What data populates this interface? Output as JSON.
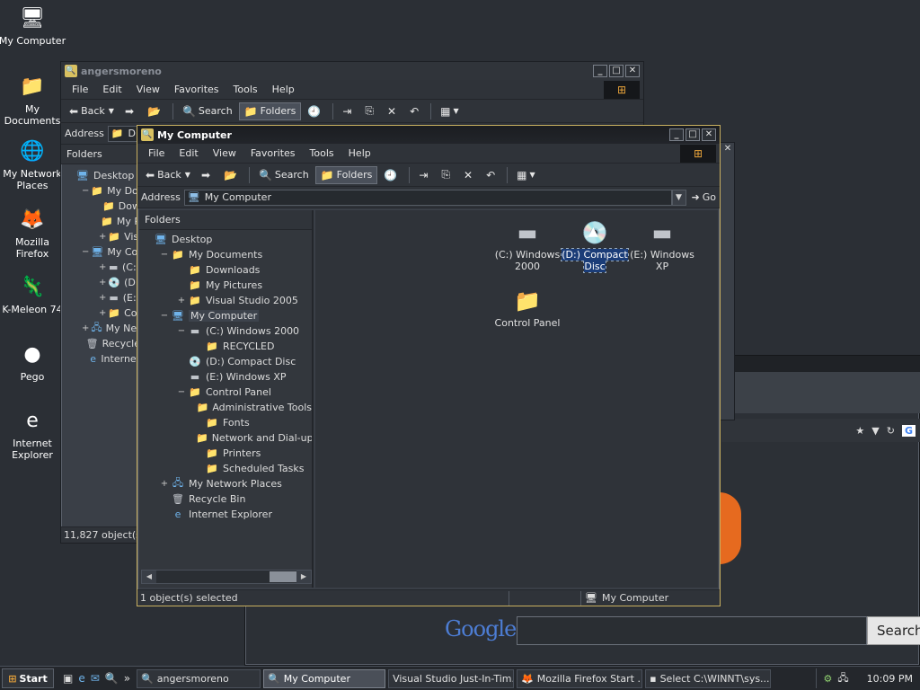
{
  "desktop": {
    "icons": [
      {
        "label": "My Computer",
        "glyph": "🖥"
      },
      {
        "label": "My Documents",
        "glyph": "📁"
      },
      {
        "label": "My Network Places",
        "glyph": "🌐"
      },
      {
        "label": "Mozilla Firefox",
        "glyph": "🦊"
      },
      {
        "label": "K-Meleon 74",
        "glyph": "🦎"
      },
      {
        "label": "Pego",
        "glyph": "●"
      },
      {
        "label": "Internet Explorer",
        "glyph": "e"
      }
    ]
  },
  "back_window": {
    "title": "angersmoreno",
    "menu": [
      "File",
      "Edit",
      "View",
      "Favorites",
      "Tools",
      "Help"
    ],
    "toolbar": {
      "back": "Back",
      "search": "Search",
      "folders": "Folders"
    },
    "address_label": "Address",
    "address_value": "D",
    "pane_title": "Folders",
    "tree": [
      {
        "indent": 0,
        "exp": "",
        "label": "Desktop",
        "icon": "desktop"
      },
      {
        "indent": 1,
        "exp": "−",
        "label": "My Docu",
        "icon": "folder"
      },
      {
        "indent": 2,
        "exp": "",
        "label": "Dow",
        "icon": "folder"
      },
      {
        "indent": 2,
        "exp": "",
        "label": "My P",
        "icon": "folder"
      },
      {
        "indent": 2,
        "exp": "+",
        "label": "Visu",
        "icon": "folder"
      },
      {
        "indent": 1,
        "exp": "−",
        "label": "My Com",
        "icon": "computer"
      },
      {
        "indent": 2,
        "exp": "+",
        "label": "(C:)",
        "icon": "drive"
      },
      {
        "indent": 2,
        "exp": "+",
        "label": "(D:)",
        "icon": "disc"
      },
      {
        "indent": 2,
        "exp": "+",
        "label": "(E:)",
        "icon": "drive"
      },
      {
        "indent": 2,
        "exp": "+",
        "label": "Con",
        "icon": "folder"
      },
      {
        "indent": 1,
        "exp": "+",
        "label": "My Netv",
        "icon": "network"
      },
      {
        "indent": 1,
        "exp": "",
        "label": "Recycle",
        "icon": "recycle"
      },
      {
        "indent": 1,
        "exp": "",
        "label": "Internet",
        "icon": "ie"
      }
    ],
    "status": "11,827 object(s)"
  },
  "front_window": {
    "title": "My Computer",
    "menu": [
      "File",
      "Edit",
      "View",
      "Favorites",
      "Tools",
      "Help"
    ],
    "toolbar": {
      "back": "Back",
      "search": "Search",
      "folders": "Folders"
    },
    "address_label": "Address",
    "address_value": "My Computer",
    "go_label": "Go",
    "pane_title": "Folders",
    "tree": [
      {
        "indent": 0,
        "exp": "",
        "label": "Desktop",
        "icon": "desktop"
      },
      {
        "indent": 1,
        "exp": "−",
        "label": "My Documents",
        "icon": "folder"
      },
      {
        "indent": 2,
        "exp": "",
        "label": "Downloads",
        "icon": "folder"
      },
      {
        "indent": 2,
        "exp": "",
        "label": "My Pictures",
        "icon": "folder"
      },
      {
        "indent": 2,
        "exp": "+",
        "label": "Visual Studio 2005",
        "icon": "folder"
      },
      {
        "indent": 1,
        "exp": "−",
        "label": "My Computer",
        "icon": "computer",
        "selected": true
      },
      {
        "indent": 2,
        "exp": "−",
        "label": "(C:) Windows 2000",
        "icon": "drive"
      },
      {
        "indent": 3,
        "exp": "",
        "label": "RECYCLED",
        "icon": "folder"
      },
      {
        "indent": 2,
        "exp": "",
        "label": "(D:) Compact Disc",
        "icon": "disc"
      },
      {
        "indent": 2,
        "exp": "",
        "label": "(E:) Windows XP",
        "icon": "drive"
      },
      {
        "indent": 2,
        "exp": "−",
        "label": "Control Panel",
        "icon": "folder"
      },
      {
        "indent": 3,
        "exp": "",
        "label": "Administrative Tools",
        "icon": "folder"
      },
      {
        "indent": 3,
        "exp": "",
        "label": "Fonts",
        "icon": "folder"
      },
      {
        "indent": 3,
        "exp": "",
        "label": "Network and Dial-up Co",
        "icon": "folder"
      },
      {
        "indent": 3,
        "exp": "",
        "label": "Printers",
        "icon": "folder"
      },
      {
        "indent": 3,
        "exp": "",
        "label": "Scheduled Tasks",
        "icon": "folder"
      },
      {
        "indent": 1,
        "exp": "+",
        "label": "My Network Places",
        "icon": "network"
      },
      {
        "indent": 1,
        "exp": "",
        "label": "Recycle Bin",
        "icon": "recycle"
      },
      {
        "indent": 1,
        "exp": "",
        "label": "Internet Explorer",
        "icon": "ie"
      }
    ],
    "items": [
      {
        "label": "(C:) Windows 2000",
        "icon": "drive"
      },
      {
        "label": "(D:) Compact Disc",
        "icon": "disc",
        "selected": true
      },
      {
        "label": "(E:) Windows XP",
        "icon": "drive"
      },
      {
        "label": "Control Panel",
        "icon": "folder"
      }
    ],
    "status_left": "1 object(s) selected",
    "status_right": "My Computer"
  },
  "browser_bg": {
    "search_button": "Search",
    "google_logo": "Google"
  },
  "taskbar": {
    "start": "Start",
    "tasks": [
      {
        "label": "angersmoreno",
        "active": false
      },
      {
        "label": "My Computer",
        "active": true
      },
      {
        "label": "Visual Studio Just-In-Tim...",
        "active": false
      },
      {
        "label": "Mozilla Firefox Start ...",
        "active": false
      },
      {
        "label": "Select C:\\WINNT\\sys...",
        "active": false
      }
    ],
    "clock": "10:09 PM"
  }
}
